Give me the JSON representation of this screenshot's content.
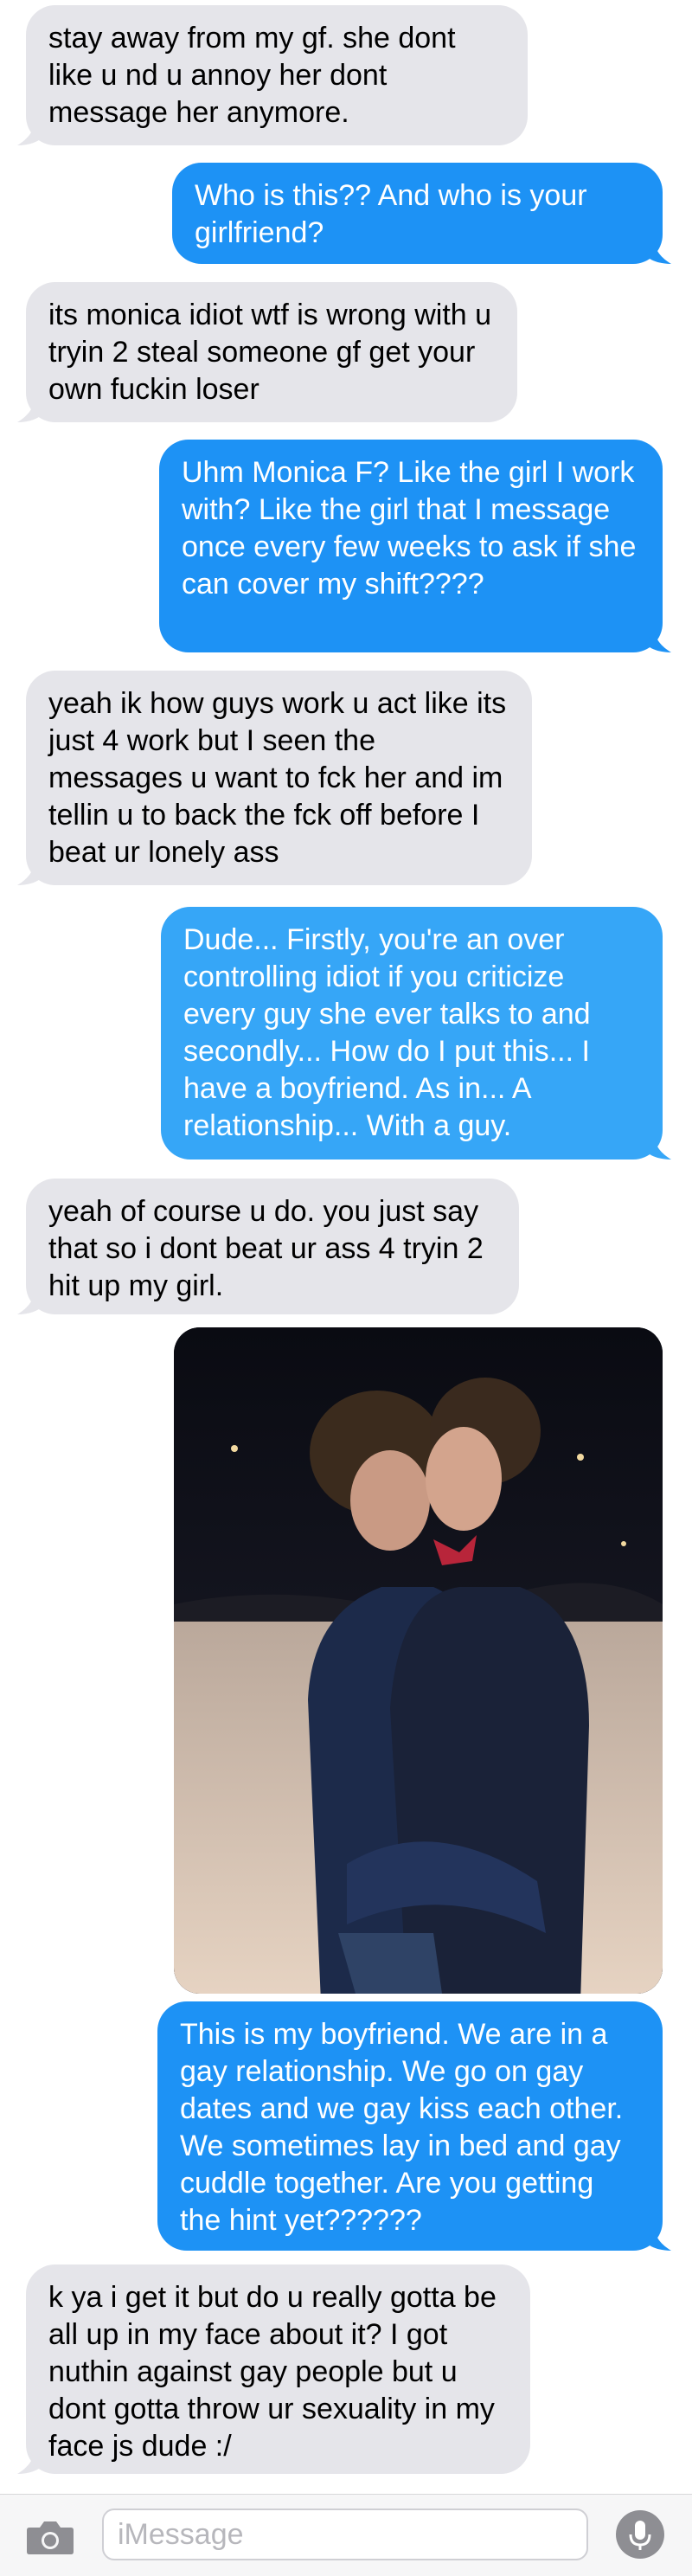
{
  "messages": [
    {
      "side": "in",
      "text": "stay away from my gf. she dont like u nd u annoy her dont message her anymore."
    },
    {
      "side": "out",
      "text": "Who is this??  And who is your girlfriend?"
    },
    {
      "side": "in",
      "text": "its monica idiot wtf is wrong with u tryin 2 steal someone gf get your own fuckin loser"
    },
    {
      "side": "out",
      "text": "Uhm Monica F?  Like the girl I work with?  Like the girl that I message once every few weeks to ask if she can cover my shift????"
    },
    {
      "side": "in",
      "text": "yeah ik how guys work u act like its just 4 work but I seen the messages u want to fck her and im tellin u to back the fck off before I beat ur lonely ass"
    },
    {
      "side": "out",
      "text": "Dude... Firstly, you're an over controlling idiot if you criticize every guy she ever talks to and secondly... How do I put this... I have a boyfriend.  As in... A relationship... With a guy."
    },
    {
      "side": "in",
      "text": "yeah of course u do. you just say that so i dont beat ur ass 4 tryin 2 hit up my girl."
    },
    {
      "side": "out",
      "type": "photo",
      "description_icon": "photo-message"
    },
    {
      "side": "out",
      "text": "This is my boyfriend.  We are in a gay relationship.  We go on gay dates and we gay kiss each other.  We sometimes lay in bed and gay cuddle together.  Are you getting the hint yet??????"
    },
    {
      "side": "in",
      "text": "k ya i get it but do u really gotta be all up in my face about it? I got nuthin against gay people but u dont gotta throw ur sexuality in my face js dude :/"
    }
  ],
  "input_bar": {
    "placeholder": "iMessage",
    "camera_icon": "camera-icon",
    "mic_icon": "microphone-icon"
  },
  "colors": {
    "incoming_bubble": "#e5e5ea",
    "outgoing_bubble": "#1d92f5",
    "incoming_text": "#000000",
    "outgoing_text": "#ffffff"
  }
}
